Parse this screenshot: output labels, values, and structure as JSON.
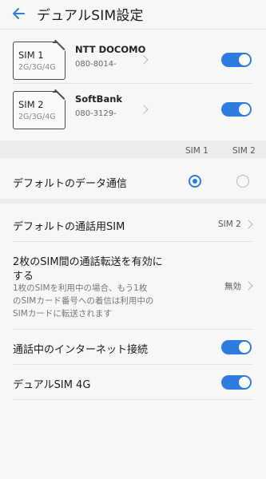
{
  "header": {
    "title": "デュアルSIM設定"
  },
  "sims": [
    {
      "name": "SIM 1",
      "network": "2G/3G/4G",
      "carrier": "NTT DOCOMO",
      "number": "080-8014-",
      "enabled": true
    },
    {
      "name": "SIM 2",
      "network": "2G/3G/4G",
      "carrier": "SoftBank",
      "number": "080-3129-",
      "enabled": true
    }
  ],
  "columns": {
    "sim1": "SIM 1",
    "sim2": "SIM 2"
  },
  "data_comm": {
    "label": "デフォルトのデータ通信",
    "selected": "SIM 1"
  },
  "call_sim": {
    "label": "デフォルトの通話用SIM",
    "value": "SIM 2"
  },
  "forwarding": {
    "label_line1": "2枚のSIM間の通話転送を有効に",
    "label_line2": "する",
    "sub_line1": "1枚のSIMを利用中の場合、もう1枚",
    "sub_line2": "のSIMカード番号への着信は利用中の",
    "sub_line3": "SIMカードに転送されます",
    "value": "無効"
  },
  "internet_during_call": {
    "label": "通話中のインターネット接続",
    "enabled": true
  },
  "dual_4g": {
    "label": "デュアルSIM 4G",
    "enabled": true
  },
  "colors": {
    "accent": "#2f7ce0",
    "background": "#f7f7f7",
    "band": "#ececec"
  }
}
